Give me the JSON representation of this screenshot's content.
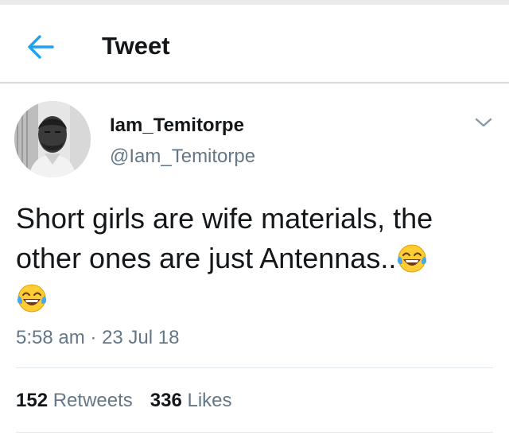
{
  "header": {
    "title": "Tweet",
    "back_icon": "arrow-left-icon",
    "accent_color": "#1da1f2"
  },
  "tweet": {
    "author": {
      "name": "Iam_Temitorpe",
      "handle": "@Iam_Temitorpe",
      "avatar_icon": "profile-photo-avatar"
    },
    "menu_icon": "chevron-down-icon",
    "text": {
      "line1": "Short girls are wife materials, the",
      "line2": "other ones are just Antennas..",
      "emoji_icon": "face-with-tears-of-joy-emoji"
    },
    "time": "5:58 am",
    "separator": "·",
    "date": "23 Jul 18",
    "stats": {
      "retweets_count": "152",
      "retweets_label": "Retweets",
      "likes_count": "336",
      "likes_label": "Likes"
    }
  }
}
